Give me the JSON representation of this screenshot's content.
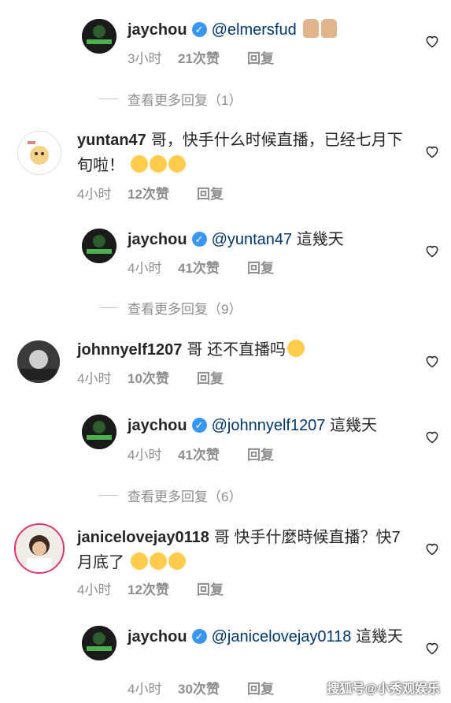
{
  "comments": [
    {
      "user": "jaychou",
      "verified": true,
      "mention": "@elmersfud",
      "text": "",
      "time": "3小时",
      "likes": "21次赞",
      "reply": "回复"
    },
    {
      "user": "yuntan47",
      "verified": false,
      "mention": "",
      "text": "哥，快手什么时候直播，已经七月下旬啦！",
      "time": "4小时",
      "likes": "12次赞",
      "reply": "回复"
    },
    {
      "user": "jaychou",
      "verified": true,
      "mention": "@yuntan47",
      "text": "這幾天",
      "time": "4小时",
      "likes": "41次赞",
      "reply": "回复"
    },
    {
      "user": "johnnyelf1207",
      "verified": false,
      "mention": "",
      "text": "哥 还不直播吗",
      "time": "4小时",
      "likes": "10次赞",
      "reply": "回复"
    },
    {
      "user": "jaychou",
      "verified": true,
      "mention": "@johnnyelf1207",
      "text": "這幾天",
      "time": "4小时",
      "likes": "41次赞",
      "reply": "回复"
    },
    {
      "user": "janicelovejay0118",
      "verified": false,
      "mention": "",
      "text": "哥 快手什麼時候直播？快7月底了",
      "time": "4小时",
      "likes": "12次赞",
      "reply": "回复"
    },
    {
      "user": "jaychou",
      "verified": true,
      "mention": "@janicelovejay0118",
      "text": "這幾天",
      "time": "4小时",
      "likes": "30次赞",
      "reply": "回复"
    }
  ],
  "more_replies": [
    "查看更多回复（1）",
    "查看更多回复（9）",
    "查看更多回复（6）"
  ],
  "watermark": "搜狐号@小秀观娱乐",
  "colors": {
    "verified": "#3897f0",
    "mention": "#003569",
    "meta": "#8e8e8e"
  }
}
